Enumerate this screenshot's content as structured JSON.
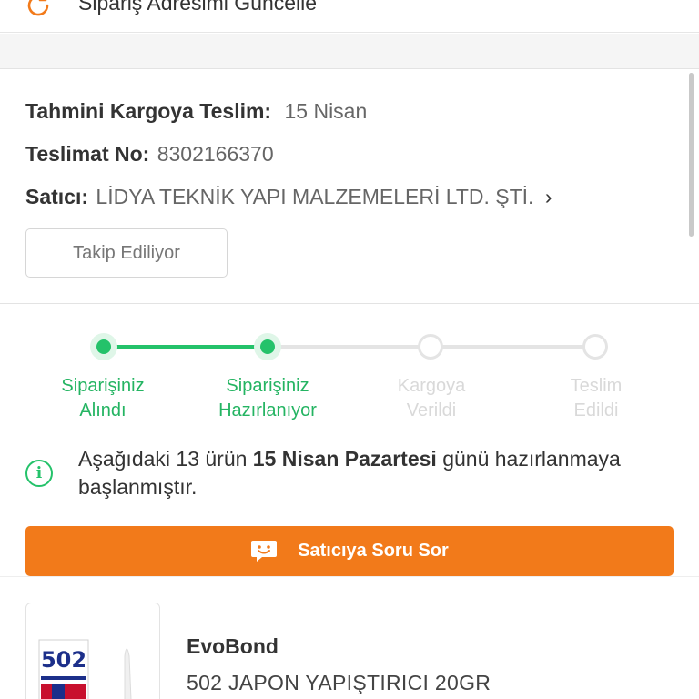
{
  "top_action": {
    "label": "Sipariş Adresimi Güncelle",
    "icon": "refresh-icon"
  },
  "order_info": {
    "estimated": {
      "label": "Tahmini Kargoya Teslim:",
      "value": "15 Nisan"
    },
    "delivery": {
      "label": "Teslimat No:",
      "value": "8302166370"
    },
    "seller": {
      "label": "Satıcı:",
      "value": "LİDYA TEKNİK YAPI MALZEMELERİ LTD. ŞTİ.",
      "chevron": "›"
    }
  },
  "follow_button": {
    "label": "Takip Ediliyor"
  },
  "tracking": {
    "steps": [
      {
        "line1": "Siparişiniz",
        "line2": "Alındı",
        "status": "done"
      },
      {
        "line1": "Siparişiniz",
        "line2": "Hazırlanıyor",
        "status": "done"
      },
      {
        "line1": "Kargoya",
        "line2": "Verildi",
        "status": "pending"
      },
      {
        "line1": "Teslim",
        "line2": "Edildi",
        "status": "pending"
      }
    ]
  },
  "notice": {
    "icon": "info-icon",
    "text_pre": "Aşağıdaki 13 ürün ",
    "text_bold": "15 Nisan Pazartesi",
    "text_post": " günü hazırlanmaya başlanmıştır."
  },
  "ask_seller": {
    "label": "Satıcıya Soru Sor",
    "icon": "chat-smile-icon"
  },
  "product": {
    "brand": "EvoBond",
    "name": "502 JAPON YAPIŞTIRICI 20GR",
    "image_label": "502"
  },
  "colors": {
    "accent_orange": "#f27a1a",
    "success_green": "#24c26a"
  }
}
